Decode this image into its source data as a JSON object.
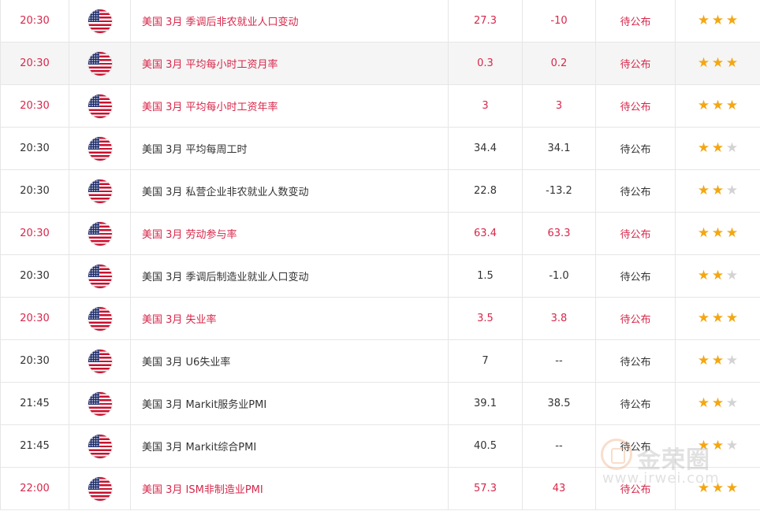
{
  "colors": {
    "highlight_text": "#d8274a",
    "normal_text": "#333333",
    "star_on": "#f3a712",
    "star_off": "#d3d3d3",
    "alt_row_bg": "#f5f5f5"
  },
  "icons": {
    "country_flag": "us-flag-icon",
    "importance": "star-icon"
  },
  "rows": [
    {
      "time": "20:30",
      "event": "美国 3月 季调后非农就业人口变动",
      "previous": "27.3",
      "forecast": "-10",
      "actual": "待公布",
      "stars": 3,
      "highlight": true
    },
    {
      "time": "20:30",
      "event": "美国 3月 平均每小时工资月率",
      "previous": "0.3",
      "forecast": "0.2",
      "actual": "待公布",
      "stars": 3,
      "highlight": true,
      "alt": true
    },
    {
      "time": "20:30",
      "event": "美国 3月 平均每小时工资年率",
      "previous": "3",
      "forecast": "3",
      "actual": "待公布",
      "stars": 3,
      "highlight": true
    },
    {
      "time": "20:30",
      "event": "美国 3月 平均每周工时",
      "previous": "34.4",
      "forecast": "34.1",
      "actual": "待公布",
      "stars": 2,
      "highlight": false
    },
    {
      "time": "20:30",
      "event": "美国 3月 私营企业非农就业人数变动",
      "previous": "22.8",
      "forecast": "-13.2",
      "actual": "待公布",
      "stars": 2,
      "highlight": false
    },
    {
      "time": "20:30",
      "event": "美国 3月 劳动参与率",
      "previous": "63.4",
      "forecast": "63.3",
      "actual": "待公布",
      "stars": 3,
      "highlight": true
    },
    {
      "time": "20:30",
      "event": "美国 3月 季调后制造业就业人口变动",
      "previous": "1.5",
      "forecast": "-1.0",
      "actual": "待公布",
      "stars": 2,
      "highlight": false
    },
    {
      "time": "20:30",
      "event": "美国 3月 失业率",
      "previous": "3.5",
      "forecast": "3.8",
      "actual": "待公布",
      "stars": 3,
      "highlight": true
    },
    {
      "time": "20:30",
      "event": "美国 3月 U6失业率",
      "previous": "7",
      "forecast": "--",
      "actual": "待公布",
      "stars": 2,
      "highlight": false
    },
    {
      "time": "21:45",
      "event": "美国 3月 Markit服务业PMI",
      "previous": "39.1",
      "forecast": "38.5",
      "actual": "待公布",
      "stars": 2,
      "highlight": false
    },
    {
      "time": "21:45",
      "event": "美国 3月 Markit综合PMI",
      "previous": "40.5",
      "forecast": "--",
      "actual": "待公布",
      "stars": 2,
      "highlight": false
    },
    {
      "time": "22:00",
      "event": "美国 3月 ISM非制造业PMI",
      "previous": "57.3",
      "forecast": "43",
      "actual": "待公布",
      "stars": 3,
      "highlight": true
    }
  ],
  "watermark": {
    "name": "金荣圈",
    "url": "www.jrwei.com"
  }
}
